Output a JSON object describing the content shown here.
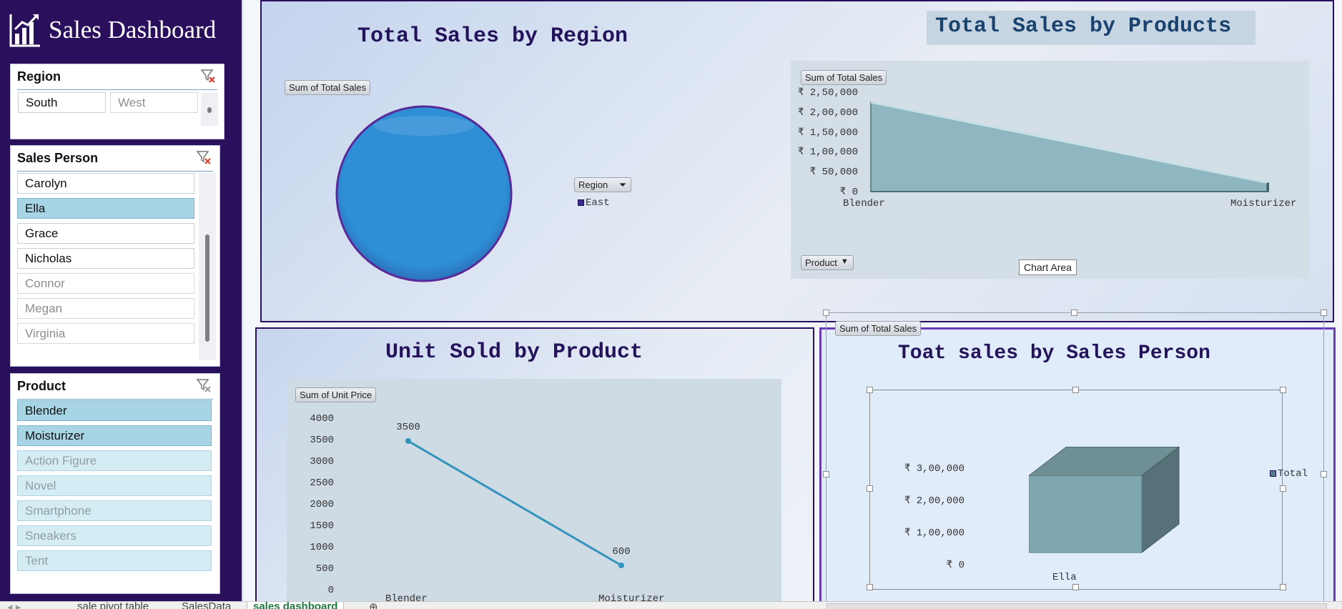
{
  "app": {
    "title": "Sales Dashboard"
  },
  "slicers": {
    "region": {
      "title": "Region",
      "items": [
        "South",
        "West"
      ]
    },
    "sales_person": {
      "title": "Sales Person",
      "items": [
        "Carolyn",
        "Ella",
        "Grace",
        "Nicholas",
        "Connor",
        "Megan",
        "Virginia"
      ],
      "selected": "Ella"
    },
    "product": {
      "title": "Product",
      "items": [
        "Blender",
        "Moisturizer",
        "Action Figure",
        "Novel",
        "Smartphone",
        "Sneakers",
        "Tent"
      ],
      "selected": [
        "Blender",
        "Moisturizer"
      ]
    }
  },
  "chart_region": {
    "title": "Total Sales by Region",
    "value_button": "Sum of Total Sales",
    "filter_button": "Region",
    "legend": [
      "East"
    ]
  },
  "chart_products": {
    "title": "Total Sales by Products",
    "value_button": "Sum of Total Sales",
    "axis_button": "Product",
    "tooltip": "Chart Area",
    "yticks": [
      "₹ 2,50,000",
      "₹ 2,00,000",
      "₹ 1,50,000",
      "₹ 1,00,000",
      "₹ 50,000",
      "₹ 0"
    ],
    "categories": [
      "Blender",
      "Moisturizer"
    ]
  },
  "chart_units": {
    "title": "Unit Sold by Product",
    "value_button": "Sum of Unit Price",
    "yticks": [
      "4000",
      "3500",
      "3000",
      "2500",
      "2000",
      "1500",
      "1000",
      "500",
      "0"
    ],
    "categories": [
      "Blender",
      "Moisturizer"
    ],
    "data_labels": [
      "3500",
      "600"
    ]
  },
  "chart_person": {
    "title": "Toat sales by Sales Person",
    "value_button": "Sum of Total Sales",
    "yticks": [
      "₹ 3,00,000",
      "₹ 2,00,000",
      "₹ 1,00,000",
      "₹ 0"
    ],
    "categories": [
      "Ella"
    ],
    "legend": [
      "Total"
    ]
  },
  "chart_data": [
    {
      "type": "pie",
      "title": "Total Sales by Region",
      "categories": [
        "East"
      ],
      "values": [
        1
      ]
    },
    {
      "type": "area",
      "title": "Total Sales by Products",
      "categories": [
        "Blender",
        "Moisturizer"
      ],
      "values": [
        225000,
        22000
      ],
      "ylim": [
        0,
        250000
      ]
    },
    {
      "type": "line",
      "title": "Unit Sold by Product",
      "categories": [
        "Blender",
        "Moisturizer"
      ],
      "values": [
        3500,
        600
      ],
      "ylim": [
        0,
        4000
      ]
    },
    {
      "type": "bar",
      "title": "Toat sales by Sales Person",
      "categories": [
        "Ella"
      ],
      "series": [
        {
          "name": "Total",
          "values": [
            250000
          ]
        }
      ],
      "ylim": [
        0,
        300000
      ]
    }
  ],
  "sheet_tabs": {
    "tabs": [
      "sale pivot table",
      "SalesData",
      "sales dashboard"
    ],
    "active": "sales dashboard"
  },
  "colors": {
    "sidebar": "#2a0f5c",
    "pie": "#2e8ed6",
    "area": "#8fb7c1",
    "line": "#3393bd",
    "cube": "#7fa7b0",
    "selected": "#a7d5e6"
  }
}
